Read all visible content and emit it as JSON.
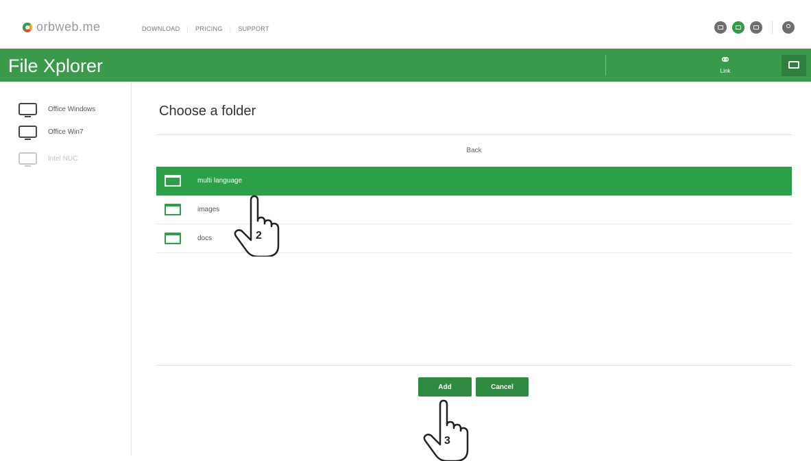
{
  "header": {
    "logo_text": "orbweb.me",
    "nav": [
      "DOWNLOAD",
      "PRICING",
      "SUPPORT"
    ]
  },
  "appbar": {
    "title": "File Xplorer",
    "link_label": "Link"
  },
  "sidebar": {
    "devices": [
      {
        "name": "Office Windows",
        "online": true
      },
      {
        "name": "Office Win7",
        "online": true
      },
      {
        "name": "Intel NUC",
        "online": false
      }
    ]
  },
  "main": {
    "title": "Choose a folder",
    "back_label": "Back",
    "folders": [
      {
        "name": "multi language",
        "selected": true
      },
      {
        "name": "images",
        "selected": false
      },
      {
        "name": "docs",
        "selected": false
      }
    ],
    "add_label": "Add",
    "cancel_label": "Cancel"
  },
  "annotations": {
    "step_2": "2",
    "step_3": "3"
  },
  "colors": {
    "brand_green": "#3a9a4c",
    "selected_row": "#2ca048",
    "button": "#2f8a41"
  }
}
